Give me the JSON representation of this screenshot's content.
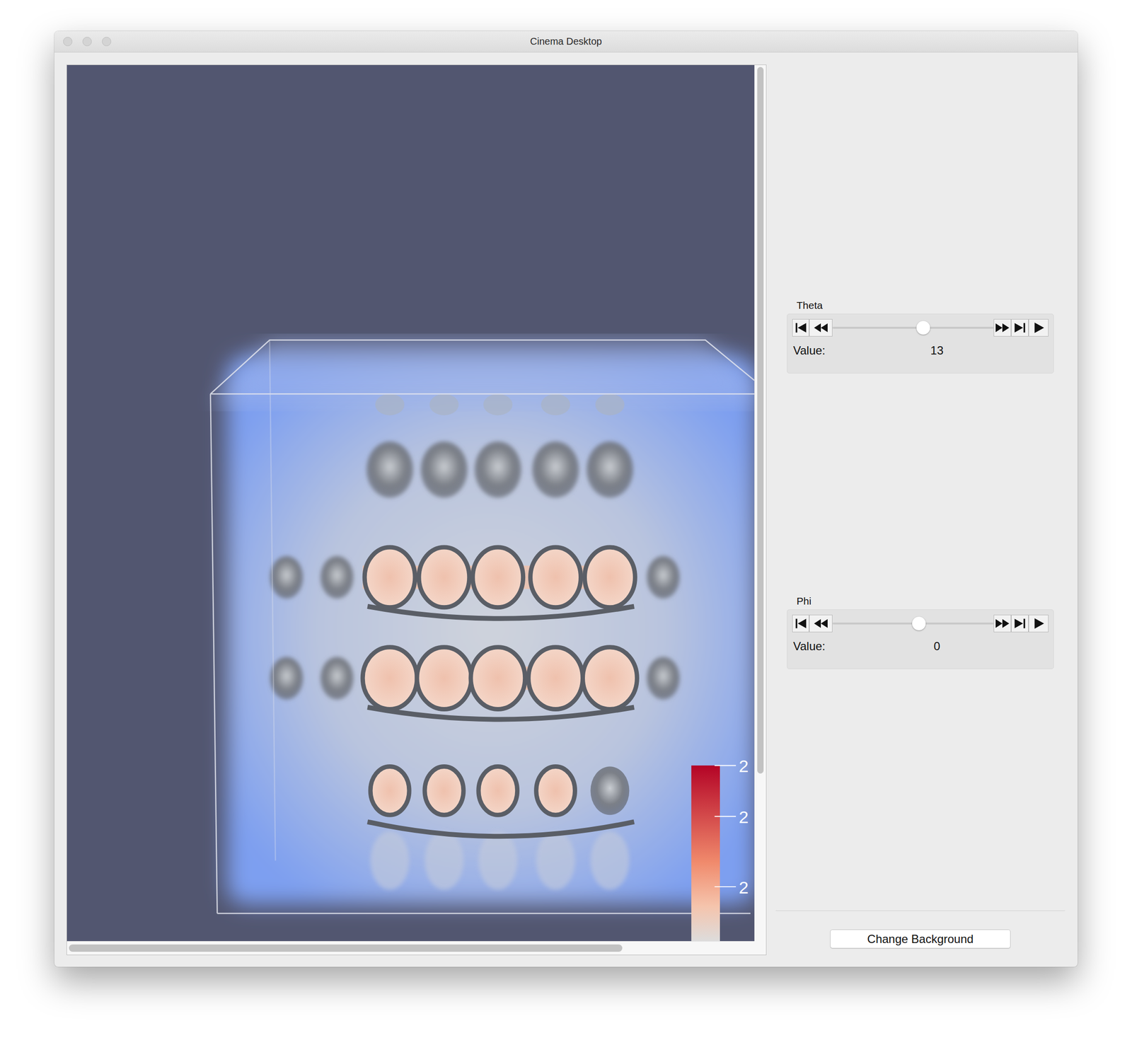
{
  "window": {
    "title": "Cinema Desktop"
  },
  "sliders": [
    {
      "label": "Theta",
      "value_label": "Value:",
      "value": "13",
      "level": 0.57
    },
    {
      "label": "Phi",
      "value_label": "Value:",
      "value": "0",
      "level": 0.54
    }
  ],
  "legend": {
    "ticks": [
      "2",
      "2",
      "2"
    ]
  },
  "scrollbars": {
    "vertical": {
      "level": 0.81
    },
    "horizontal": {
      "level": 0.81
    }
  },
  "buttons": [
    "Change Background"
  ]
}
